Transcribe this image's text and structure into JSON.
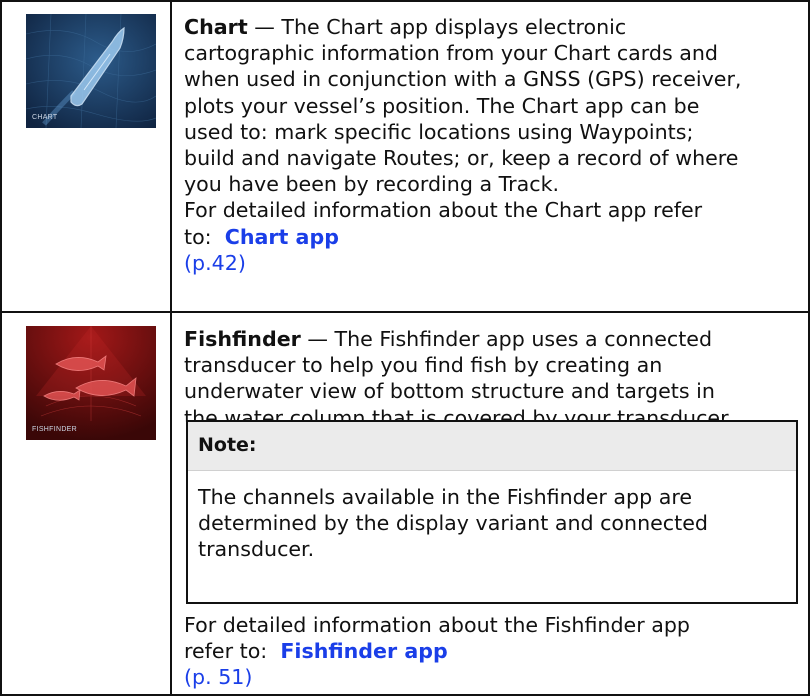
{
  "apps": [
    {
      "thumbnail_label": "CHART",
      "name": "Chart",
      "dash": " — ",
      "description_lines": [
        "The Chart app displays electronic",
        "cartographic information from your Chart cards and",
        "when used in conjunction with a GNSS (GPS) receiver,",
        "plots your vessel’s position. The Chart app can be",
        "used to: mark specific locations using Waypoints;",
        "build and navigate Routes; or, keep a record of where",
        "you have been by recording a Track."
      ],
      "refer_lines": [
        "For detailed information about the Chart app refer",
        "to:"
      ],
      "link_text": "Chart app",
      "page_ref": "(p.42)"
    },
    {
      "thumbnail_label": "FISHFINDER",
      "name": "Fishfinder",
      "dash": " — ",
      "description_lines": [
        "The Fishfinder app uses a connected",
        "transducer to help you find fish by creating an",
        "underwater view of bottom structure and targets in",
        "the water column that is covered by your transducer."
      ],
      "note": {
        "title": "Note:",
        "lines": [
          "The channels available in the Fishfinder app are",
          "determined by the display variant and connected",
          "transducer."
        ]
      },
      "refer_lines": [
        "For detailed information about the Fishfinder app",
        "refer to:"
      ],
      "link_text": "Fishfinder app",
      "page_ref": "(p. 51)"
    }
  ],
  "colors": {
    "link": "#1a3ee8",
    "border": "#111111",
    "note_header_bg": "#ebebeb",
    "chart_thumb_bg": "#1b3a5e",
    "fishfinder_thumb_bg": "#5a0c0c"
  },
  "icons": [
    "boat-icon",
    "fish-icon"
  ]
}
